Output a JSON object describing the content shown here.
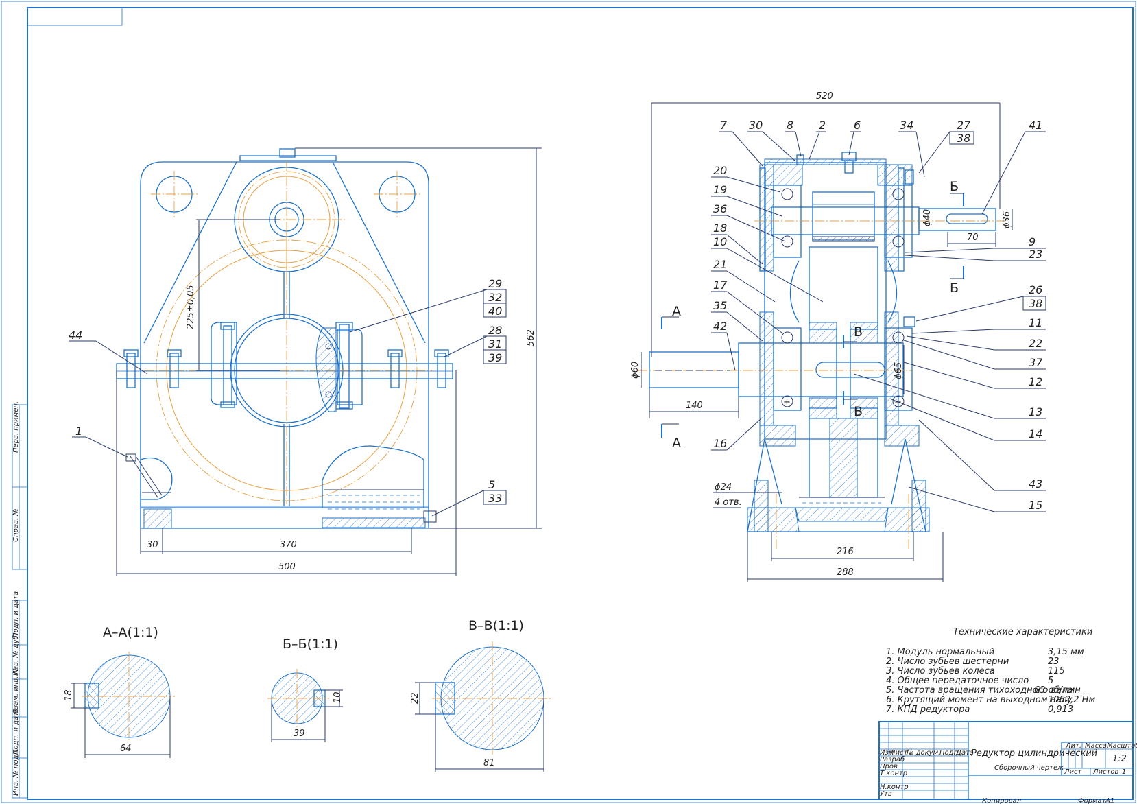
{
  "dimensions": {
    "d520": "520",
    "d562": "562",
    "d225": "225±0,05",
    "d500": "500",
    "d370": "370",
    "d30": "30",
    "d140": "140",
    "d60": "ϕ60",
    "d70": "70",
    "d36": "ϕ36",
    "d40": "ϕ40",
    "d65": "ϕ65",
    "d216": "216",
    "d288": "288",
    "d24": "ϕ24",
    "holes": "4 отв.",
    "d18": "18",
    "d64": "64",
    "d10": "10",
    "d39": "39",
    "d22": "22",
    "d81": "81"
  },
  "front_callouts": {
    "c29": "29",
    "c32": "32",
    "c40": "40",
    "c28": "28",
    "c31": "31",
    "c39": "39",
    "c44": "44",
    "c1": "1",
    "c5": "5",
    "c33": "33"
  },
  "side_callouts": {
    "c7": "7",
    "c30": "30",
    "c8": "8",
    "c2": "2",
    "c6": "6",
    "c34": "34",
    "c27": "27",
    "c38a": "38",
    "c41": "41",
    "c20": "20",
    "c19": "19",
    "c36": "36",
    "c18": "18",
    "c10": "10",
    "c21": "21",
    "c17": "17",
    "c35": "35",
    "c42": "42",
    "c16": "16",
    "c9": "9",
    "c23": "23",
    "c26": "26",
    "c38b": "38",
    "c11": "11",
    "c22": "22",
    "c37": "37",
    "c12": "12",
    "c13": "13",
    "c14": "14",
    "c43": "43",
    "c15": "15"
  },
  "section_marks": {
    "a": "А",
    "b": "Б",
    "v": "В"
  },
  "sections": {
    "aa": "А–А(1:1)",
    "bb": "Б–Б(1:1)",
    "vv": "В–В(1:1)"
  },
  "tech": {
    "title": "Технические характеристики",
    "rows": [
      {
        "label": "1.  Модуль нормальный",
        "value": "3,15 мм"
      },
      {
        "label": "2.  Число зубьев шестерни",
        "value": "23"
      },
      {
        "label": "3.  Число зубьев колеса",
        "value": "115"
      },
      {
        "label": "4.  Общее передаточное число",
        "value": "5"
      },
      {
        "label": "5.  Частота вращения тихоходного вала",
        "value": "63 об/мин"
      },
      {
        "label": "6.  Крутящий момент на выходном валу",
        "value": "1062,2 Нм"
      },
      {
        "label": "7.  КПД редуктора",
        "value": "0,913"
      }
    ]
  },
  "title_block": {
    "name": "Редуктор цилиндрический",
    "doc": "Сборочный чертеж",
    "h_izm": "Изм",
    "h_list": "Лист",
    "h_ndoc": "№ докум.",
    "h_podp": "Подп",
    "h_data": "Дата",
    "r_razrab": "Разраб",
    "r_prov": "Пров",
    "r_tkontr": "Т.контр",
    "r_nkontr": "Н.контр",
    "r_utv": "Утв",
    "lit": "Лит.",
    "massa": "Масса",
    "masshtab": "Масштаб",
    "scale": "1:2",
    "sheet": "Лист",
    "sheets": "Листов",
    "sheets_n": "1",
    "kopiroval": "Копировал",
    "format": "Формат",
    "format_v": "А1"
  },
  "left_strip": [
    "Перв. примен.",
    "Справ. №",
    "Подп. и дата",
    "Инв. № дубл.",
    "Взам. инв. №",
    "Подп. и дата",
    "Инв. № подл."
  ]
}
